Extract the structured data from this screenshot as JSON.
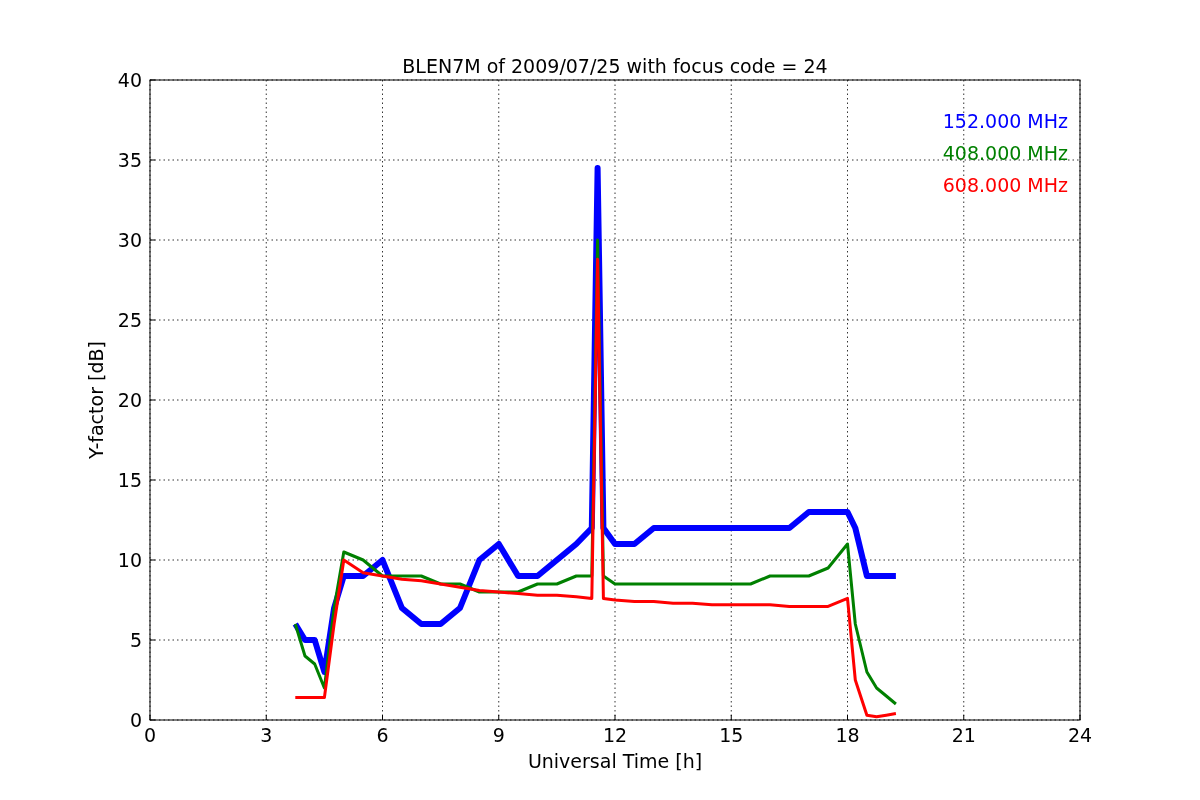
{
  "figure": {
    "chart_data": {
      "type": "line",
      "title": "BLEN7M of 2009/07/25 with focus code = 24",
      "xlabel": "Universal Time [h]",
      "ylabel": "Y-factor [dB]",
      "x": [
        3.75,
        4.0,
        4.25,
        4.5,
        4.75,
        5.0,
        5.5,
        6.0,
        6.5,
        7.0,
        7.5,
        8.0,
        8.5,
        9.0,
        9.5,
        10.0,
        10.5,
        11.0,
        11.4,
        11.55,
        11.7,
        12.0,
        12.5,
        13.0,
        13.5,
        14.0,
        14.5,
        15.0,
        15.5,
        16.0,
        16.5,
        17.0,
        17.5,
        18.0,
        18.2,
        18.5,
        18.75,
        19.0,
        19.25
      ],
      "series": [
        {
          "name": "152.000 MHz",
          "color": "#0000ff",
          "values": [
            6,
            5,
            5,
            3,
            7,
            9,
            9,
            10,
            7,
            6,
            6,
            7,
            10,
            11,
            9,
            9,
            10,
            11,
            12,
            34.5,
            12,
            11,
            11,
            12,
            12,
            12,
            12,
            12,
            12,
            12,
            12,
            13,
            13,
            13,
            12,
            9,
            9,
            9,
            9
          ]
        },
        {
          "name": "408.000 MHz",
          "color": "#008000",
          "values": [
            6,
            4,
            3.5,
            2,
            7,
            10.5,
            10,
            9,
            9,
            9,
            8.5,
            8.5,
            8,
            8,
            8,
            8.5,
            8.5,
            9,
            9,
            30,
            9,
            8.5,
            8.5,
            8.5,
            8.5,
            8.5,
            8.5,
            8.5,
            8.5,
            9,
            9,
            9,
            9.5,
            11,
            6,
            3,
            2,
            1.5,
            1
          ]
        },
        {
          "name": "608.000 MHz",
          "color": "#ff0000",
          "values": [
            1.4,
            1.4,
            1.4,
            1.4,
            6,
            10,
            9.2,
            9,
            8.8,
            8.7,
            8.5,
            8.3,
            8.1,
            8,
            7.9,
            7.8,
            7.8,
            7.7,
            7.6,
            28.8,
            7.6,
            7.5,
            7.4,
            7.4,
            7.3,
            7.3,
            7.2,
            7.2,
            7.2,
            7.2,
            7.1,
            7.1,
            7.1,
            7.6,
            2.5,
            0.3,
            0.2,
            0.3,
            0.4
          ]
        }
      ],
      "xlim": [
        0,
        24
      ],
      "ylim": [
        0,
        40
      ],
      "xticks": [
        0,
        3,
        6,
        9,
        12,
        15,
        18,
        21,
        24
      ],
      "yticks": [
        0,
        5,
        10,
        15,
        20,
        25,
        30,
        35,
        40
      ],
      "grid": true
    }
  }
}
